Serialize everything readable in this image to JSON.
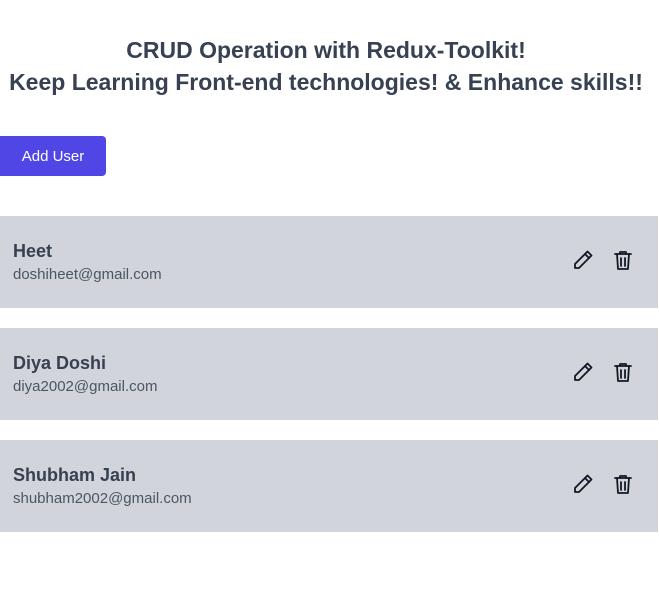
{
  "header": {
    "title_line1": "CRUD Operation with Redux-Toolkit!",
    "title_line2": "Keep Learning Front-end technologies! & Enhance skills!!"
  },
  "toolbar": {
    "add_user_label": "Add User"
  },
  "users": [
    {
      "name": "Heet",
      "email": "doshiheet@gmail.com"
    },
    {
      "name": "Diya Doshi",
      "email": "diya2002@gmail.com"
    },
    {
      "name": "Shubham Jain",
      "email": "shubham2002@gmail.com"
    }
  ],
  "icons": {
    "edit": "pencil-icon",
    "delete": "trash-icon"
  },
  "colors": {
    "accent": "#4f46e5",
    "card_background": "#d1d5db",
    "text": "#374151"
  }
}
